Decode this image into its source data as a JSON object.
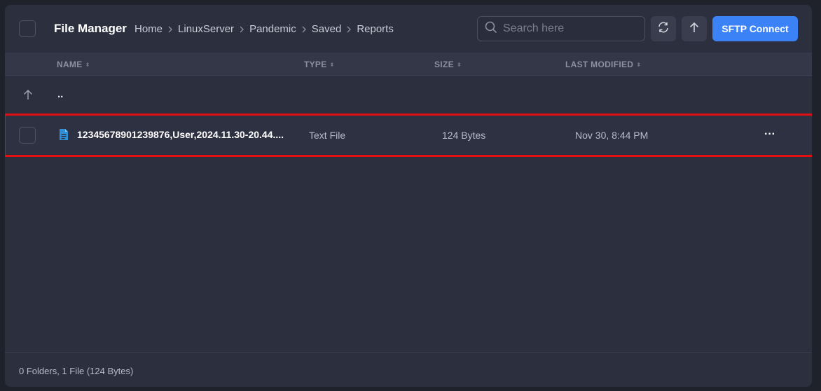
{
  "header": {
    "title": "File Manager",
    "breadcrumbs": [
      "Home",
      "LinuxServer",
      "Pandemic",
      "Saved",
      "Reports"
    ],
    "search_placeholder": "Search here",
    "sftp_label": "SFTP Connect"
  },
  "columns": {
    "name": "NAME",
    "type": "TYPE",
    "size": "SIZE",
    "modified": "LAST MODIFIED"
  },
  "parent_row": {
    "label": ".."
  },
  "files": [
    {
      "name": "12345678901239876,User,2024.11.30-20.44....",
      "type": "Text File",
      "size": "124 Bytes",
      "modified": "Nov 30, 8:44 PM",
      "more": "···"
    }
  ],
  "footer": {
    "summary": "0 Folders, 1 File (124 Bytes)"
  },
  "colors": {
    "accent": "#3b82f6",
    "highlight": "#e30e12",
    "file_icon": "#2f8fd8",
    "panel": "#2c2f3e"
  }
}
